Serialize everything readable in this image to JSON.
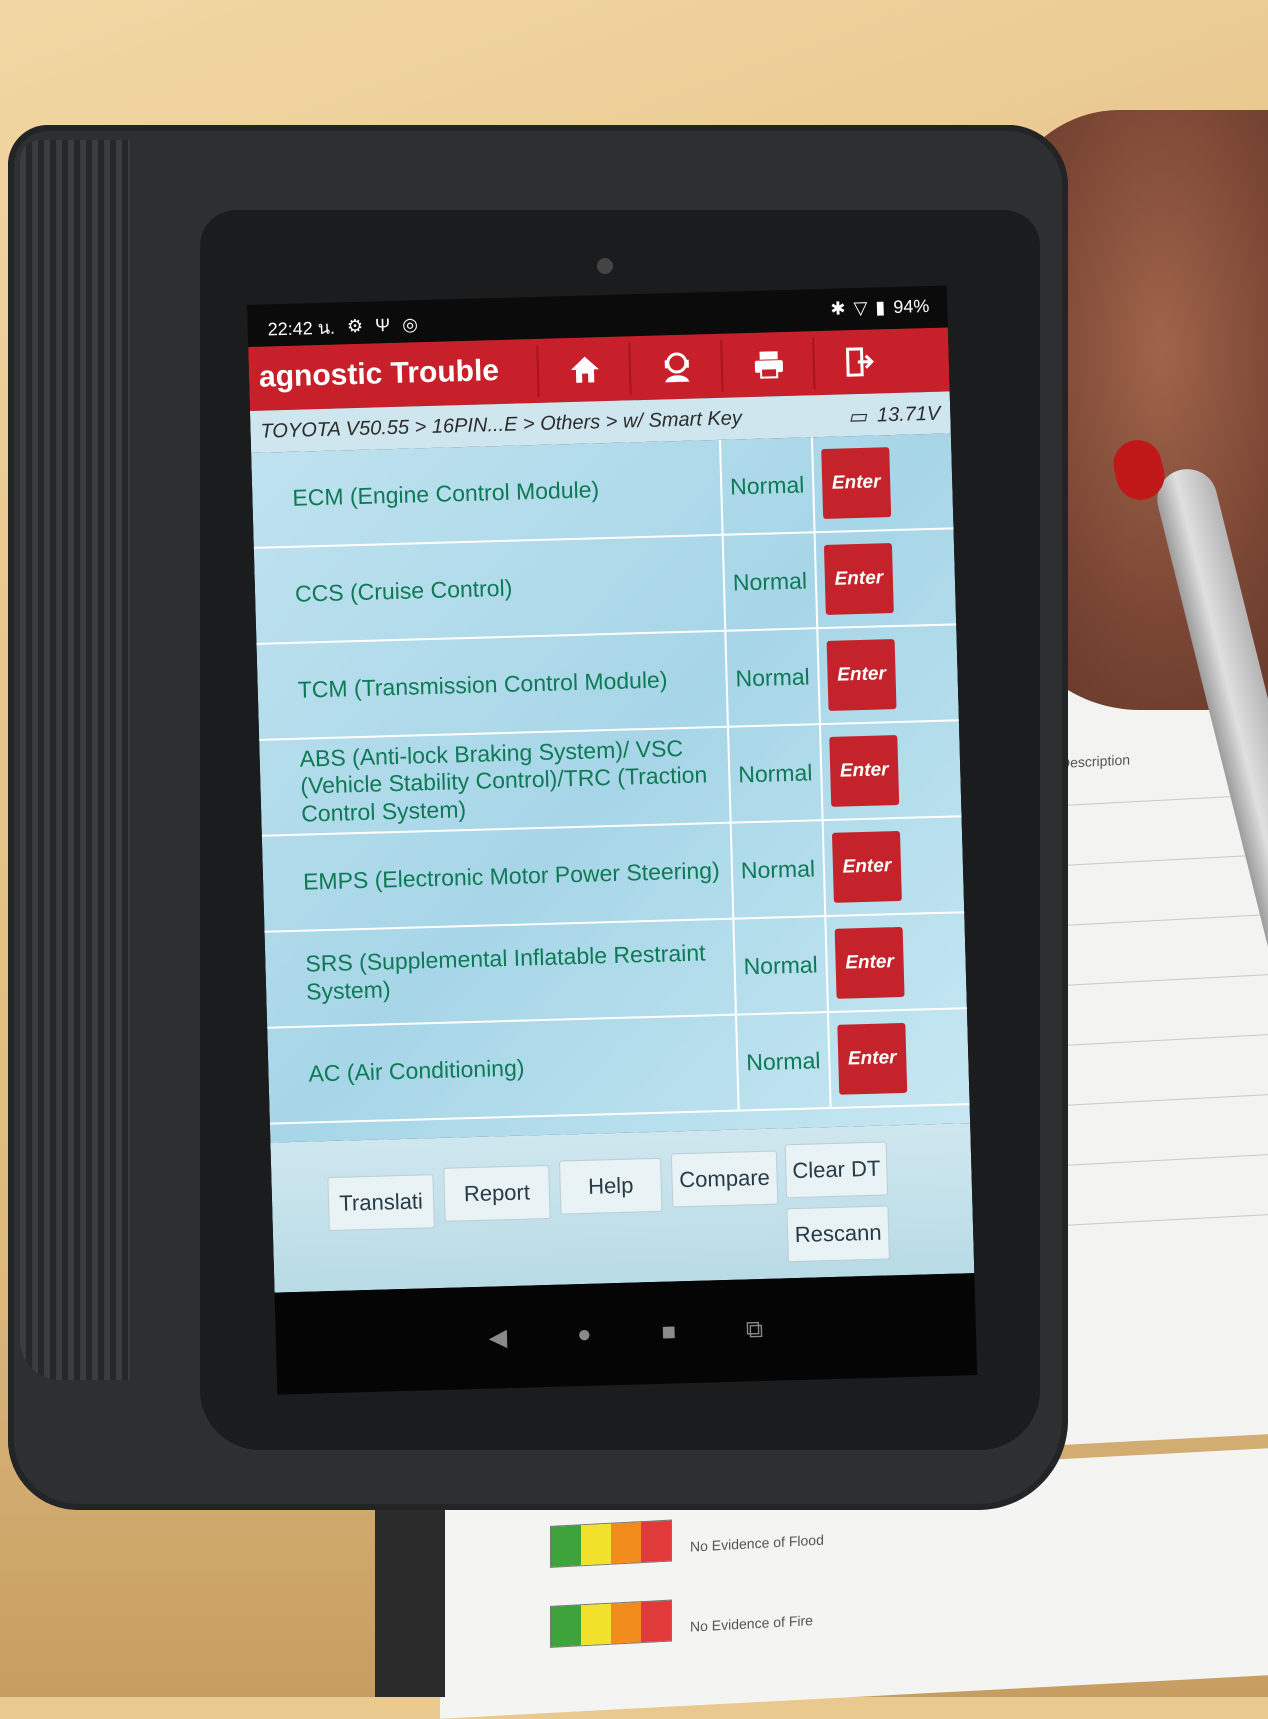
{
  "status_bar": {
    "time": "22:42 น.",
    "battery": "94%"
  },
  "app_bar": {
    "title": "agnostic Trouble",
    "buttons": [
      {
        "icon": "home-icon"
      },
      {
        "icon": "support-icon"
      },
      {
        "icon": "print-icon"
      },
      {
        "icon": "exit-icon"
      }
    ]
  },
  "breadcrumb": {
    "path": "TOYOTA V50.55 > 16PIN...E > Others > w/ Smart Key",
    "voltage": "13.71V"
  },
  "systems": [
    {
      "name": "ECM (Engine Control Module)",
      "status": "Normal",
      "action": "Enter"
    },
    {
      "name": "CCS (Cruise Control)",
      "status": "Normal",
      "action": "Enter"
    },
    {
      "name": "TCM (Transmission Control Module)",
      "status": "Normal",
      "action": "Enter"
    },
    {
      "name": "ABS (Anti-lock Braking System)/ VSC (Vehicle Stability Control)/TRC (Traction Control System)",
      "status": "Normal",
      "action": "Enter"
    },
    {
      "name": "EMPS (Electronic Motor Power Steering)",
      "status": "Normal",
      "action": "Enter"
    },
    {
      "name": "SRS (Supplemental Inflatable Restraint System)",
      "status": "Normal",
      "action": "Enter"
    },
    {
      "name": "AC (Air Conditioning)",
      "status": "Normal",
      "action": "Enter"
    }
  ],
  "actions": {
    "translate": "Translati",
    "report": "Report",
    "help": "Help",
    "compare": "Compare",
    "clear_dtc": "Clear DT",
    "rescan": "Rescann"
  },
  "paper": {
    "description": "Description",
    "flood": "No Evidence of Flood",
    "fire": "No Evidence of Fire"
  },
  "colors": {
    "accent_red": "#c8202a",
    "status_green": "#0e7a55",
    "list_bg": "#a7d6e8"
  }
}
